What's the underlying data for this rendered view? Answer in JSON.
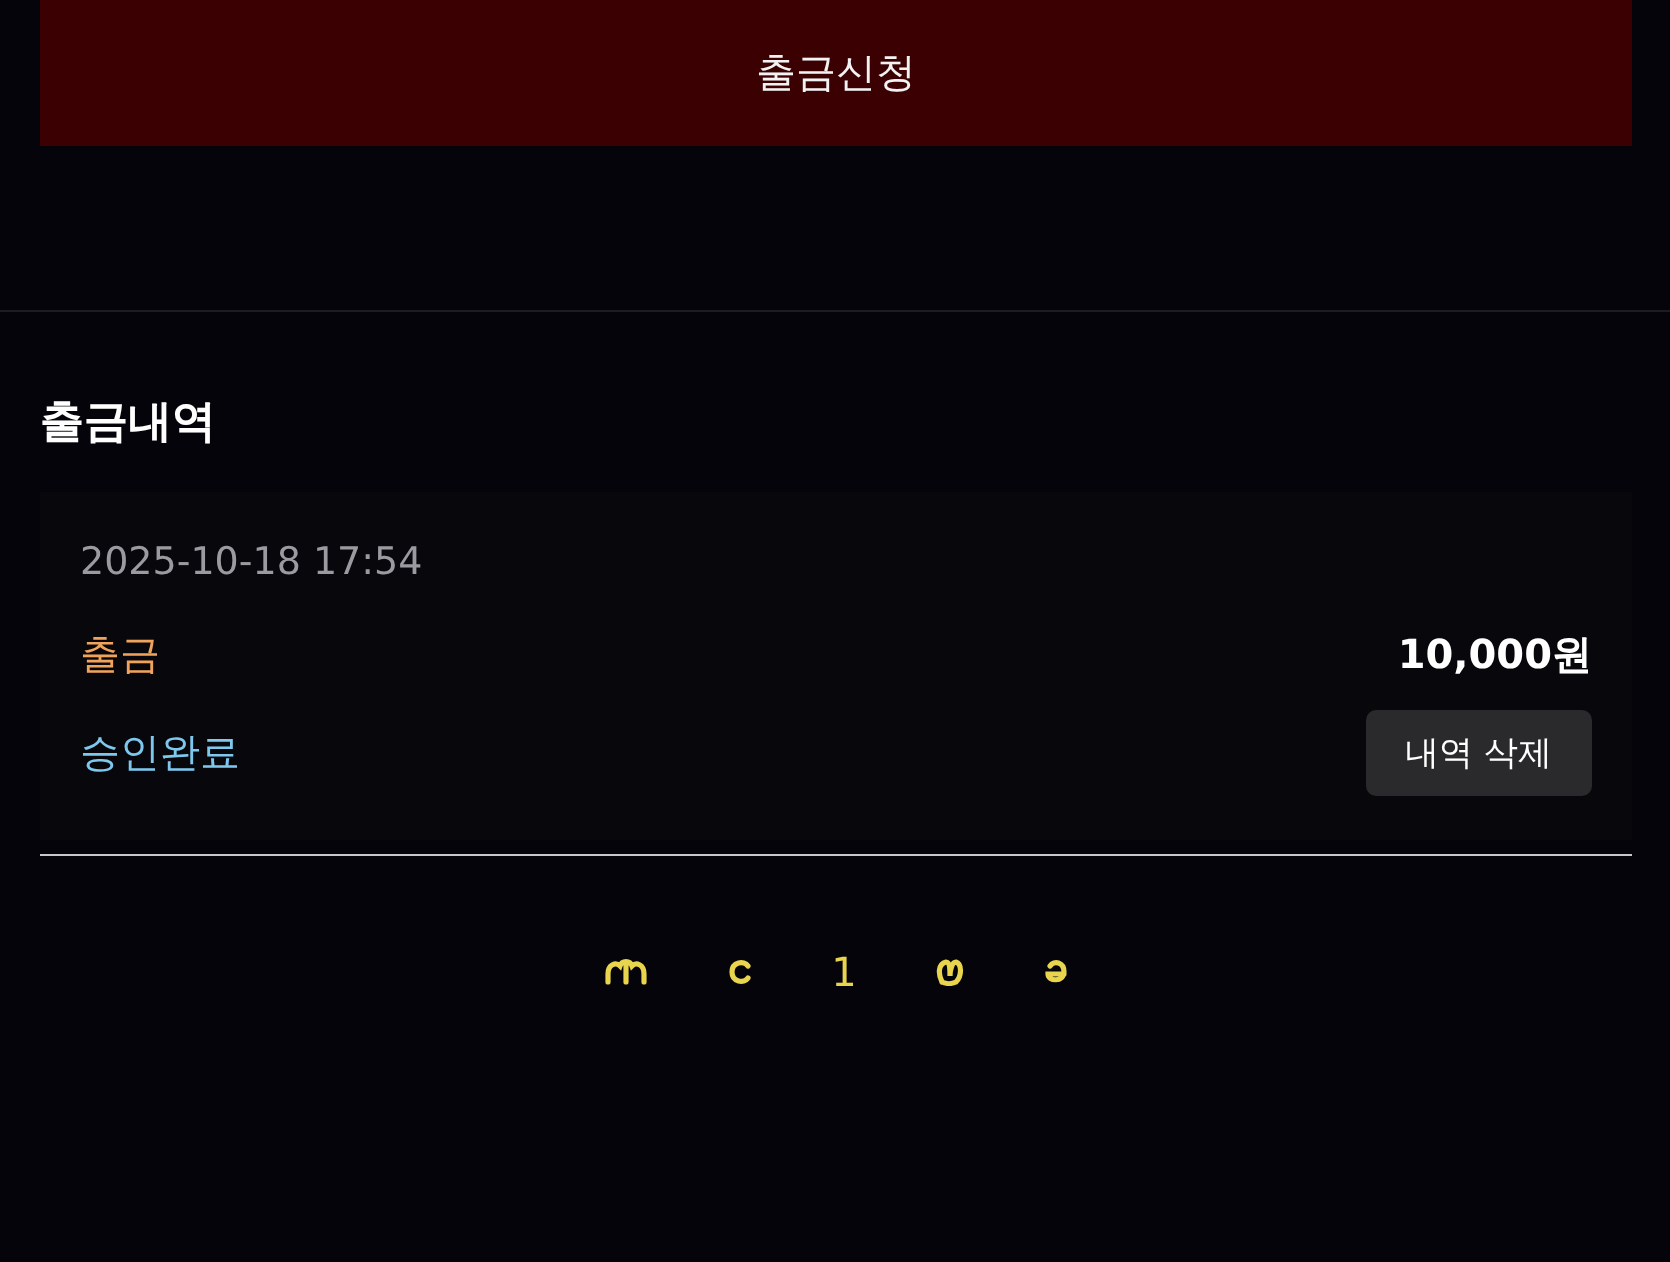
{
  "withdraw_button": "출금신청",
  "history": {
    "title": "출금내역",
    "entries": [
      {
        "datetime": "2025-10-18 17:54",
        "type": "출금",
        "amount": "10,000원",
        "status": "승인완료",
        "delete_button": "내역 삭제"
      }
    ]
  },
  "pagination": {
    "pages": [
      {
        "label": "1",
        "selected": true
      }
    ]
  }
}
